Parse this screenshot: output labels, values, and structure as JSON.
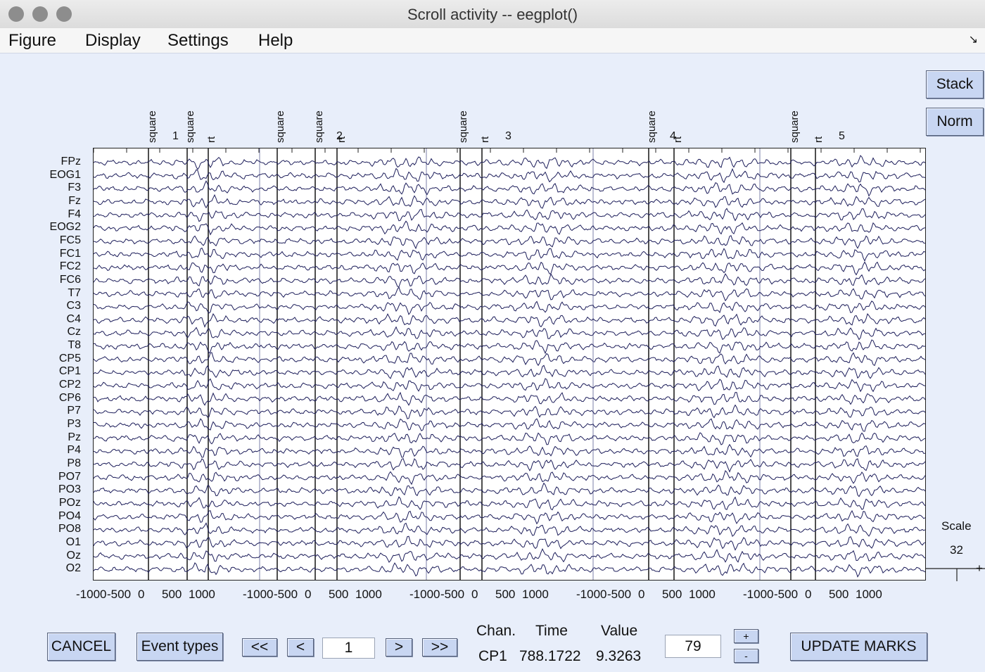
{
  "window": {
    "title": "Scroll activity -- eegplot()"
  },
  "menu": [
    "Figure",
    "Display",
    "Settings",
    "Help"
  ],
  "side_buttons": {
    "stack": "Stack",
    "norm": "Norm"
  },
  "scale": {
    "label": "Scale",
    "value": "32",
    "plus": "+"
  },
  "channels": [
    "FPz",
    "EOG1",
    "F3",
    "Fz",
    "F4",
    "EOG2",
    "FC5",
    "FC1",
    "FC2",
    "FC6",
    "T7",
    "C3",
    "C4",
    "Cz",
    "T8",
    "CP5",
    "CP1",
    "CP2",
    "CP6",
    "P7",
    "P3",
    "Pz",
    "P4",
    "P8",
    "PO7",
    "PO3",
    "POz",
    "PO4",
    "PO8",
    "O1",
    "Oz",
    "O2"
  ],
  "x_ticks": [
    "-1000",
    "-500",
    "0",
    "500",
    "1000"
  ],
  "epochs": [
    "1",
    "2",
    "3",
    "4",
    "5"
  ],
  "events": {
    "square": "square",
    "rt": "rt"
  },
  "controls": {
    "cancel": "CANCEL",
    "event_types": "Event types",
    "first": "<<",
    "prev": "<",
    "epoch_value": "1",
    "next": ">",
    "last": ">>",
    "update_marks": "UPDATE MARKS",
    "spacing_value": "79",
    "plus": "+",
    "minus": "-"
  },
  "readout": {
    "chan_label": "Chan.",
    "time_label": "Time",
    "value_label": "Value",
    "chan_value": "CP1",
    "time_value": "788.1722",
    "value_value": "9.3263"
  },
  "colors": {
    "trace": "#1c1d5a",
    "background": "#e8eefa",
    "button": "#c8d6f2"
  }
}
